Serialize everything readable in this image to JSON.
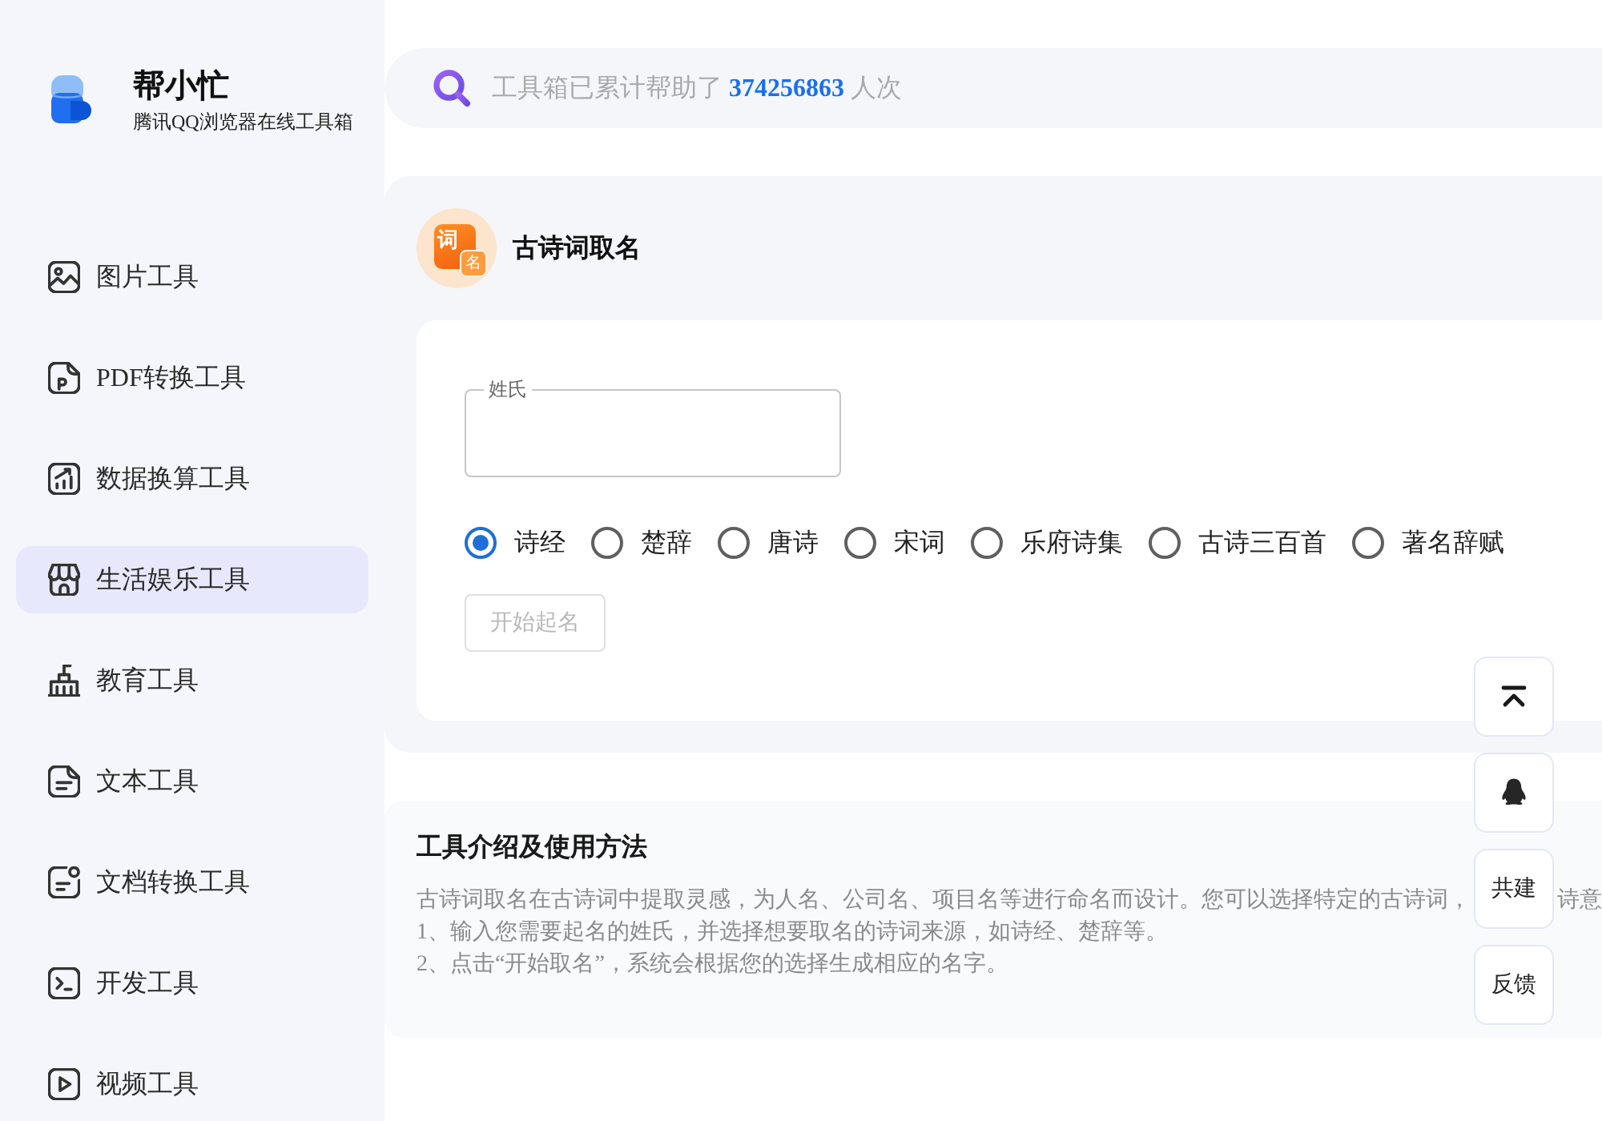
{
  "brand": {
    "name": "帮小忙",
    "tagline": "腾讯QQ浏览器在线工具箱"
  },
  "sidebar": {
    "items": [
      {
        "label": "图片工具",
        "selected": false
      },
      {
        "label": "PDF转换工具",
        "selected": false
      },
      {
        "label": "数据换算工具",
        "selected": false
      },
      {
        "label": "生活娱乐工具",
        "selected": true
      },
      {
        "label": "教育工具",
        "selected": false
      },
      {
        "label": "文本工具",
        "selected": false
      },
      {
        "label": "文档转换工具",
        "selected": false
      },
      {
        "label": "开发工具",
        "selected": false
      },
      {
        "label": "视频工具",
        "selected": false
      }
    ]
  },
  "search": {
    "prefix": "工具箱已累计帮助了",
    "count": "374256863",
    "suffix": "人次"
  },
  "tool": {
    "logo_main": "词",
    "logo_badge": "名",
    "title": "古诗词取名",
    "surname_field": {
      "label": "姓氏"
    },
    "sources": [
      {
        "label": "诗经",
        "selected": true
      },
      {
        "label": "楚辞",
        "selected": false
      },
      {
        "label": "唐诗",
        "selected": false
      },
      {
        "label": "宋词",
        "selected": false
      },
      {
        "label": "乐府诗集",
        "selected": false
      },
      {
        "label": "古诗三百首",
        "selected": false
      },
      {
        "label": "著名辞赋",
        "selected": false
      }
    ],
    "start_button": {
      "label": "开始起名",
      "disabled": true
    }
  },
  "intro": {
    "title": "工具介绍及使用方法",
    "paragraphs": [
      {
        "text": "古诗词取名在古诗词中提取灵感，为人名、公司名、项目名等进行命名而设计。您可以选择特定的古诗词，",
        "right_fragment": "诗意"
      },
      {
        "text": "1、输入您需要起名的姓氏，并选择想要取名的诗词来源，如诗经、楚辞等。"
      },
      {
        "text": "2、点击“开始取名”，系统会根据您的选择生成相应的名字。"
      }
    ]
  },
  "float_buttons": [
    {
      "kind": "top"
    },
    {
      "kind": "penguin"
    },
    {
      "kind": "label",
      "label": "共建"
    },
    {
      "kind": "label",
      "label": "反馈"
    }
  ]
}
